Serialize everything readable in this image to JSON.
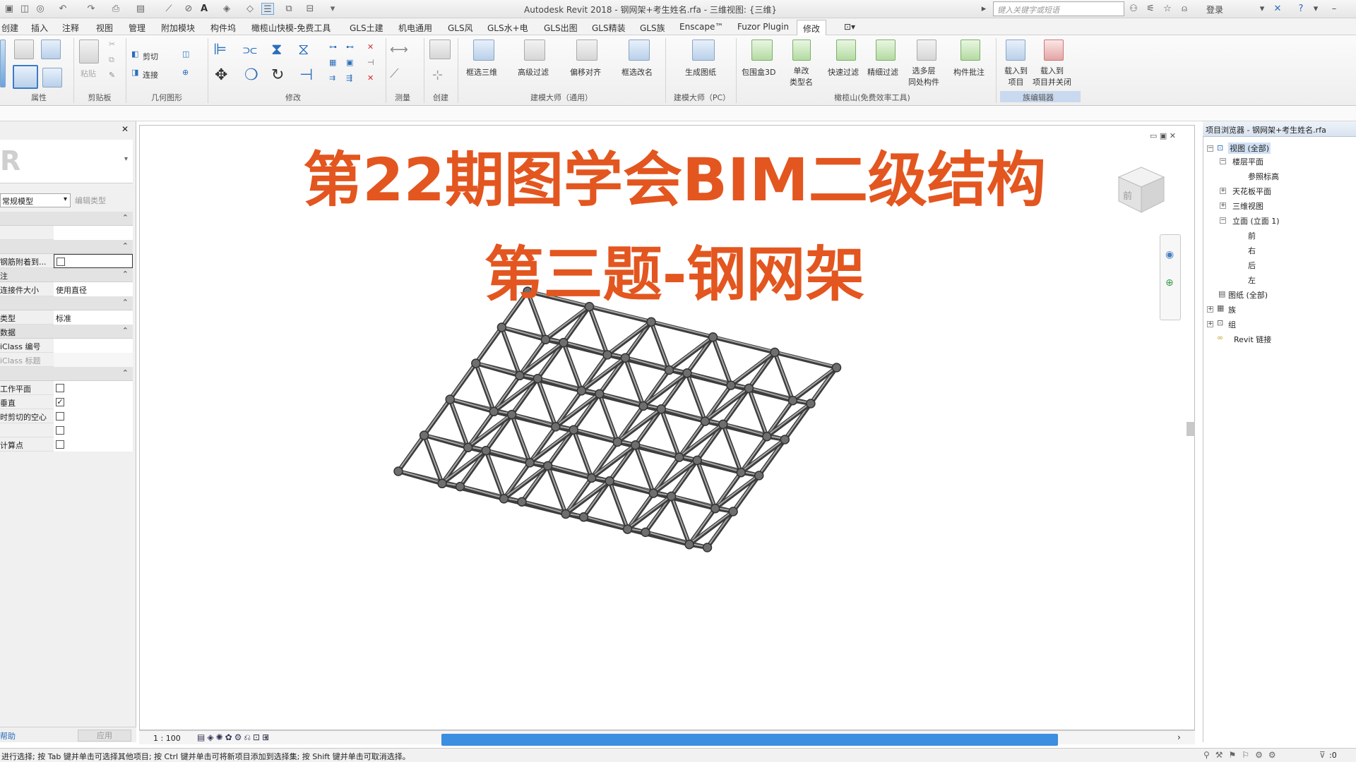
{
  "app": {
    "title": "Autodesk Revit 2018 -    钢网架+考生姓名.rfa - 三维视图: {三维}",
    "search_placeholder": "键入关键字或短语",
    "login": "登录"
  },
  "menu": {
    "tabs": [
      "创建",
      "插入",
      "注释",
      "视图",
      "管理",
      "附加模块",
      "构件坞",
      "橄榄山快模-免费工具",
      "GLS土建",
      "机电通用",
      "GLS风",
      "GLS水+电",
      "GLS出图",
      "GLS精装",
      "GLS族",
      "Enscape™",
      "Fuzor Plugin",
      "修改"
    ],
    "active": "修改"
  },
  "ribbon": {
    "groups": [
      "属性",
      "剪贴板",
      "几何图形",
      "修改",
      "测量",
      "创建",
      "建模大师（通用）",
      "建模大师（PC）",
      "橄榄山(免费效率工具)",
      "族编辑器"
    ],
    "labels": {
      "paste": "粘贴",
      "cut": "剪切",
      "join": "连接",
      "box3d": "框选三维",
      "adv_filter": "高级过滤",
      "offset_align": "偏移对齐",
      "rename": "框选改名",
      "gen_drawing": "生成图纸",
      "bbox3d": "包围盒3D",
      "single_rename": "单改\n类型名",
      "quick_filter": "快速过滤",
      "fine_filter": "精细过滤",
      "multi_layer": "选多层\n同处构件",
      "batch": "构件批注",
      "load_project": "载入到\n项目",
      "load_close": "载入到\n项目并关闭"
    }
  },
  "properties": {
    "type_label": "常规模型",
    "edit_type": "编辑类型",
    "rows": [
      {
        "key": "钢筋附着到...",
        "type": "checkbox",
        "checked": false
      },
      {
        "key": "注",
        "type": "group"
      },
      {
        "key": "连接件大小",
        "type": "text",
        "value": "使用直径"
      },
      {
        "key": "类型",
        "type": "text",
        "value": "标准"
      },
      {
        "key": "iClass 编号",
        "type": "text",
        "value": ""
      },
      {
        "key": "iClass 标题",
        "type": "text",
        "value": ""
      },
      {
        "key": "工作平面",
        "type": "checkbox",
        "checked": false
      },
      {
        "key": "垂直",
        "type": "checkbox",
        "checked": true
      },
      {
        "key": "时剪切的空心",
        "type": "checkbox",
        "checked": false
      },
      {
        "key": "",
        "type": "checkbox",
        "checked": false
      },
      {
        "key": "计算点",
        "type": "checkbox",
        "checked": false
      }
    ],
    "groups": [
      "注",
      "数据"
    ],
    "apply": "应用",
    "help": "帮助"
  },
  "canvas": {
    "title_line1": "第22期图学会BIM二级结构",
    "title_line2": "第三题-钢网架",
    "scale": "1 : 100",
    "title_color": "#e3561f"
  },
  "viewcube": {
    "face": "前"
  },
  "browser": {
    "title": "项目浏览器 - 钢网架+考生姓名.rfa",
    "nodes": [
      {
        "label": "视图 (全部)",
        "level": 0,
        "expanded": true,
        "selected": true
      },
      {
        "label": "楼层平面",
        "level": 1,
        "expanded": true
      },
      {
        "label": "参照标高",
        "level": 2
      },
      {
        "label": "天花板平面",
        "level": 1,
        "expanded": false
      },
      {
        "label": "三维视图",
        "level": 1,
        "expanded": false
      },
      {
        "label": "立面 (立面 1)",
        "level": 1,
        "expanded": true
      },
      {
        "label": "前",
        "level": 2
      },
      {
        "label": "右",
        "level": 2
      },
      {
        "label": "后",
        "level": 2
      },
      {
        "label": "左",
        "level": 2
      },
      {
        "label": "图纸 (全部)",
        "level": 0
      },
      {
        "label": "族",
        "level": 0,
        "expanded": false
      },
      {
        "label": "组",
        "level": 0,
        "expanded": false
      },
      {
        "label": "Revit 链接",
        "level": 0
      }
    ]
  },
  "status": {
    "text": "进行选择; 按 Tab 键并单击可选择其他项目; 按 Ctrl 键并单击可将新项目添加到选择集; 按 Shift 键并单击可取消选择。",
    "filter_count": ":0"
  }
}
